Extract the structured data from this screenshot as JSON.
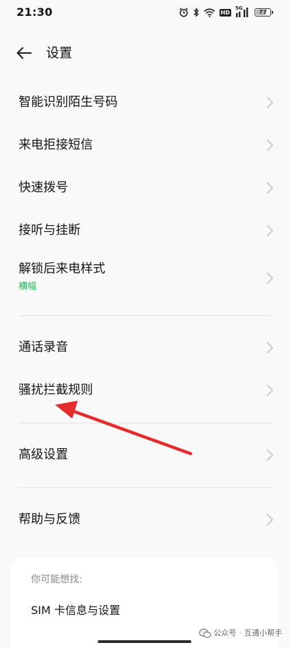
{
  "status_bar": {
    "time": "21:30",
    "network": "5G",
    "hd": "HD",
    "battery_level": "77",
    "battery_fraction": 0.77,
    "icons": [
      "alarm-icon",
      "bluetooth-icon",
      "wifi-icon",
      "hd-icon",
      "signal-icon",
      "battery-icon"
    ]
  },
  "header": {
    "title": "设置",
    "back_icon": "back-arrow-icon"
  },
  "settings": {
    "group1": [
      {
        "label": "智能识别陌生号码"
      },
      {
        "label": "来电拒接短信"
      },
      {
        "label": "快速拨号"
      },
      {
        "label": "接听与挂断"
      },
      {
        "label": "解锁后来电样式",
        "value": "横幅"
      }
    ],
    "group2": [
      {
        "label": "通话录音"
      },
      {
        "label": "骚扰拦截规则"
      }
    ],
    "group3": [
      {
        "label": "高级设置"
      }
    ],
    "group4": [
      {
        "label": "帮助与反馈"
      }
    ]
  },
  "suggest": {
    "heading": "你可能想找:",
    "items": [
      {
        "label": "SIM 卡信息与设置"
      }
    ]
  },
  "watermark": {
    "source": "公众号",
    "separator": "·",
    "account": "互通小帮手"
  },
  "colors": {
    "accent_green": "#2fb257",
    "annotation_red": "#e52b2b",
    "background": "#f9f9f9"
  }
}
